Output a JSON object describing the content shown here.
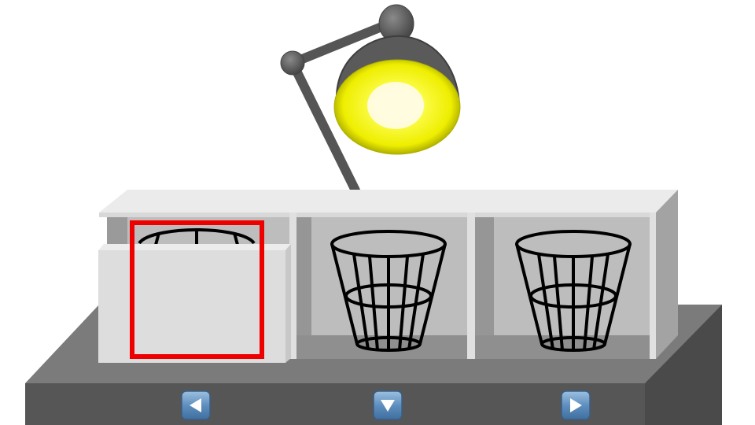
{
  "scene": {
    "colors": {
      "background": "#ffffff",
      "lamp_body": "#555555",
      "lamp_bulb": "#f4f40a",
      "lamp_glow": "#fffbd0",
      "cabinet_top": "#ececec",
      "cabinet_inner": "#bdbdbd",
      "table_top": "#7b7b7b",
      "table_front": "#555555",
      "selection": "#ee0000",
      "button_face": "#5f8fbf"
    },
    "lamp": {
      "state": "on",
      "icon": "desk-lamp-icon"
    },
    "compartments": [
      {
        "id": "left",
        "contents": "wastebasket-icon",
        "door": "open",
        "selected": true
      },
      {
        "id": "middle",
        "contents": "wastebasket-icon",
        "door": "none",
        "selected": false
      },
      {
        "id": "right",
        "contents": "wastebasket-icon",
        "door": "none",
        "selected": false
      }
    ]
  },
  "controls": {
    "left": {
      "icon": "arrow-left-icon"
    },
    "down": {
      "icon": "arrow-down-icon"
    },
    "right": {
      "icon": "arrow-right-icon"
    }
  }
}
